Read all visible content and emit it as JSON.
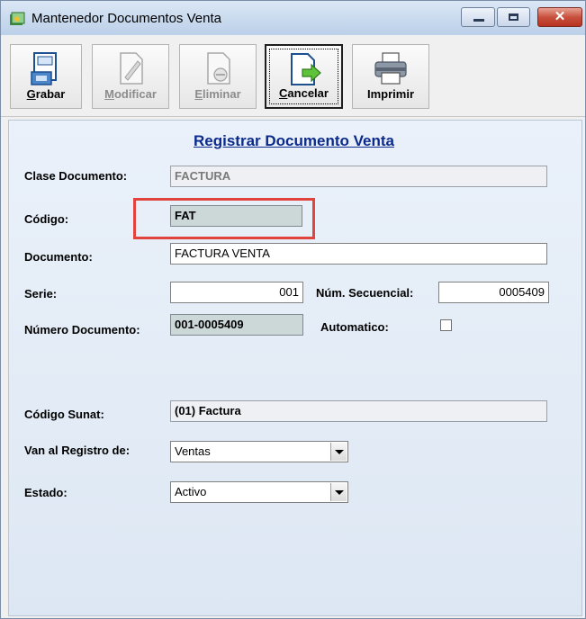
{
  "window": {
    "title": "Mantenedor Documentos Venta",
    "close_glyph": "✕"
  },
  "toolbar": {
    "buttons": [
      {
        "id": "grabar",
        "accel": "G",
        "rest": "rabar",
        "icon": "save-icon",
        "enabled": true
      },
      {
        "id": "modificar",
        "accel": "M",
        "rest": "odificar",
        "icon": "edit-icon",
        "enabled": false
      },
      {
        "id": "eliminar",
        "accel": "E",
        "rest": "liminar",
        "icon": "delete-icon",
        "enabled": false
      },
      {
        "id": "cancelar",
        "accel": "C",
        "rest": "ancelar",
        "icon": "cancel-icon",
        "enabled": true
      },
      {
        "id": "imprimir",
        "accel": "",
        "rest": "Imprimir",
        "icon": "printer-icon",
        "enabled": true
      }
    ]
  },
  "form": {
    "title": "Registrar Documento Venta",
    "clase_documento": {
      "label": "Clase Documento:",
      "value": "FACTURA"
    },
    "codigo": {
      "label": "Código:",
      "value": "FAT"
    },
    "documento": {
      "label": "Documento:",
      "value": "FACTURA VENTA"
    },
    "serie": {
      "label": "Serie:",
      "value": "001"
    },
    "num_secuencial": {
      "label": "Núm. Secuencial:",
      "value": "0005409"
    },
    "numero_documento": {
      "label": "Número Documento:",
      "value": "001-0005409"
    },
    "automatico": {
      "label": "Automatico:",
      "checked": false
    },
    "codigo_sunat": {
      "label": "Código Sunat:",
      "value": "(01) Factura"
    },
    "van_registro": {
      "label": "Van al Registro de:",
      "value": "Ventas"
    },
    "estado": {
      "label": "Estado:",
      "value": "Activo"
    }
  },
  "colors": {
    "title_blue": "#0b2a8c",
    "highlight_red": "#e0443c"
  }
}
